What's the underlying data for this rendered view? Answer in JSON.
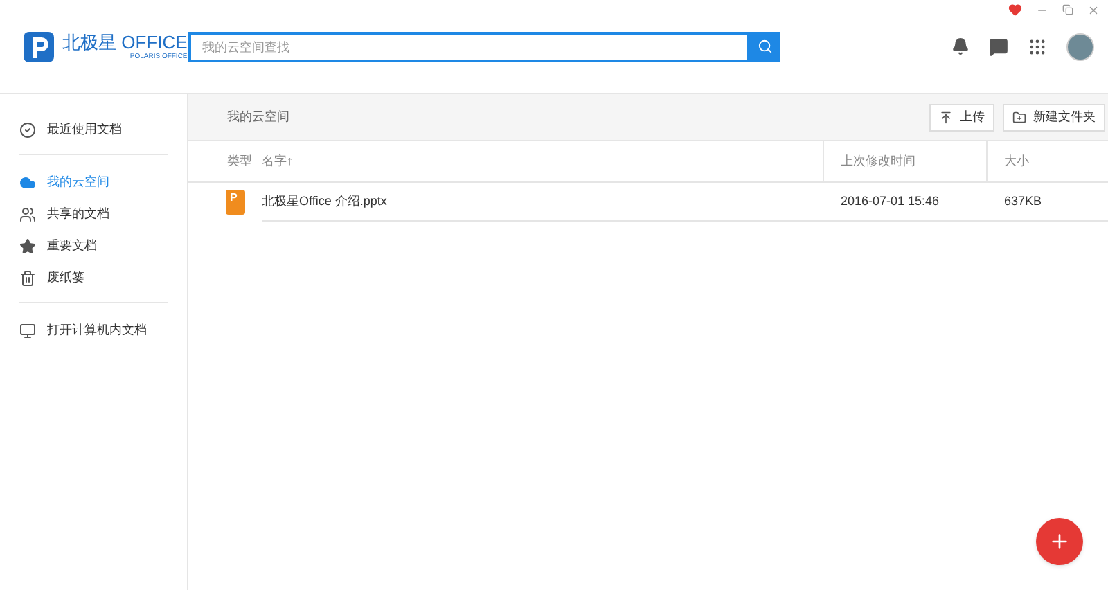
{
  "app": {
    "logo_title": "北极星 OFFICE",
    "logo_subtitle": "POLARIS OFFICE"
  },
  "search": {
    "placeholder": "我的云空间查找"
  },
  "sidebar": {
    "groups": [
      {
        "items": [
          {
            "label": "最近使用文档",
            "selected": false
          }
        ]
      },
      {
        "items": [
          {
            "label": "我的云空间",
            "selected": true
          },
          {
            "label": "共享的文档",
            "selected": false
          },
          {
            "label": "重要文档",
            "selected": false
          },
          {
            "label": "废纸篓",
            "selected": false
          }
        ]
      },
      {
        "items": [
          {
            "label": "打开计算机内文档",
            "selected": false
          }
        ]
      }
    ]
  },
  "breadcrumb": "我的云空间",
  "toolbar": [
    {
      "label": "上传"
    },
    {
      "label": "新建文件夹"
    }
  ],
  "table": {
    "columns": [
      "类型",
      "名字↑",
      "上次修改时间",
      "大小"
    ],
    "rows": [
      {
        "type_icon": "P",
        "name": "北极星Office 介绍.pptx",
        "modified": "2016-07-01 15:46",
        "size": "637KB"
      }
    ]
  }
}
